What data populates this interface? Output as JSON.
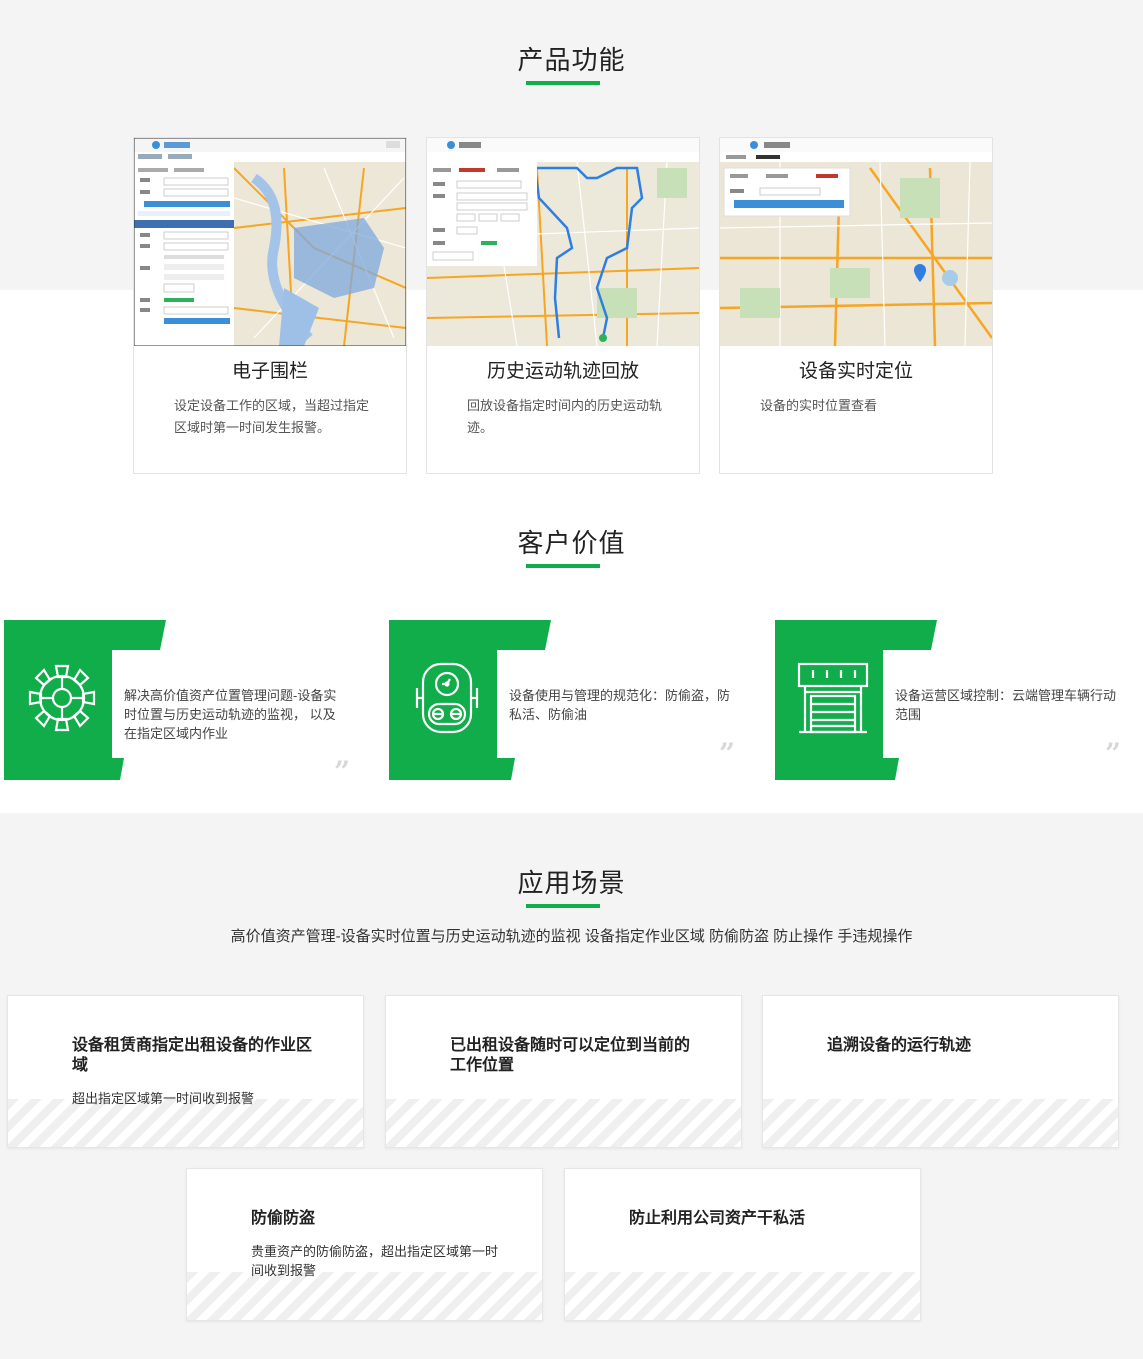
{
  "sections": {
    "features_title": "产品功能",
    "value_title": "客户价值",
    "scene_title": "应用场景"
  },
  "features": [
    {
      "title": "电子围栏",
      "desc": "设定设备工作的区域，当超过指定区域时第一时间发生报警。",
      "screen_title": "位置管理"
    },
    {
      "title": "历史运动轨迹回放",
      "desc": "回放设备指定时间内的历史运动轨迹。",
      "screen_title": "位置管理"
    },
    {
      "title": "设备实时定位",
      "desc": "设备的实时位置查看",
      "screen_title": "位置管理"
    }
  ],
  "values": [
    {
      "icon": "gear-wheel-icon",
      "text": "解决高价值资产位置管理问题-设备实时位置与历史运动轨迹的监视， 以及在指定区域内作业"
    },
    {
      "icon": "robot-device-icon",
      "text": "设备使用与管理的规范化：防偷盗，防私活、防偷油"
    },
    {
      "icon": "garage-shutter-icon",
      "text": "设备运营区域控制：云端管理车辆行动范围"
    }
  ],
  "scene_subtitle": "高价值资产管理-设备实时位置与历史运动轨迹的监视 设备指定作业区域 防偷防盗 防止操作 手违规操作",
  "scenes": [
    {
      "title": "设备租赁商指定出租设备的作业区域",
      "desc": "超出指定区域第一时间收到报警"
    },
    {
      "title": "已出租设备随时可以定位到当前的工作位置",
      "desc": ""
    },
    {
      "title": "追溯设备的运行轨迹",
      "desc": ""
    },
    {
      "title": "防偷防盗",
      "desc": "贵重资产的防偷防盗，超出指定区域第一时间收到报警"
    },
    {
      "title": "防止利用公司资产干私活",
      "desc": ""
    }
  ],
  "colors": {
    "accent": "#12ad4b"
  }
}
